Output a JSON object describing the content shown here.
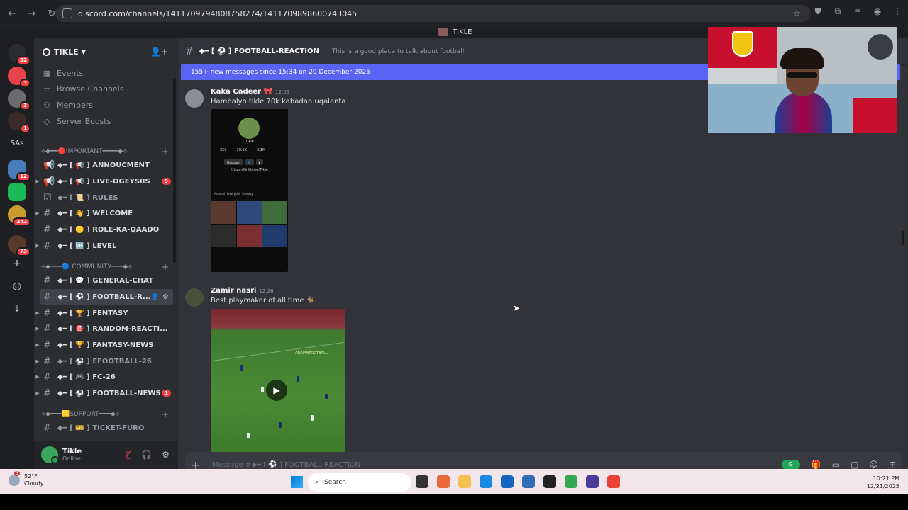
{
  "browser": {
    "url": "discord.com/channels/1411709794808758274/1411709898600743045"
  },
  "window": {
    "title": "TIKLE"
  },
  "guilds": {
    "badges": [
      "32",
      "3",
      "3",
      "1",
      "12",
      "242",
      "73"
    ],
    "sas_label": "SAs"
  },
  "server": {
    "name": "TIKLE",
    "nav": [
      {
        "label": "Events",
        "icon": "calendar-icon"
      },
      {
        "label": "Browse Channels",
        "icon": "browse-icon"
      },
      {
        "label": "Members",
        "icon": "members-icon"
      },
      {
        "label": "Server Boosts",
        "icon": "boost-icon"
      }
    ],
    "categories": [
      {
        "label": "⟡◆━━🔴IMPORTANT━━━━◆⟡"
      },
      {
        "label": "⟡◆━━━🔵 COMMUNITY━━━◆⟡"
      },
      {
        "label": "⟡◆━━━🟨SUPPORT━━━◆⟡"
      }
    ],
    "channels": [
      {
        "name": "◆━ [ 📢 ] ANNOUCMENT",
        "hash": "📢",
        "badge": ""
      },
      {
        "name": "◆━ [ 📢 ] LIVE-OGEYSIIS",
        "hash": "📢",
        "badge": "9"
      },
      {
        "name": "◆━ [ 📜 ] RULES",
        "hash": "☑",
        "badge": ""
      },
      {
        "name": "◆━ [ 👋 ] WELCOME",
        "hash": "#",
        "badge": ""
      },
      {
        "name": "◆━ [ 🟡 ] ROLE-KA-QAADO",
        "hash": "#",
        "badge": ""
      },
      {
        "name": "◆━ [ 🆙 ] LEVEL",
        "hash": "#",
        "badge": ""
      },
      {
        "name": "◆━ [ 💬 ] GENERAL-CHAT",
        "hash": "#",
        "badge": ""
      },
      {
        "name": "◆━ [ ⚽ ] FOOTBALL-R...",
        "hash": "#",
        "badge": ""
      },
      {
        "name": "◆━ [ 🏆 ] FENTASY",
        "hash": "#",
        "badge": ""
      },
      {
        "name": "◆━ [ 🎯 ] RANDOM-REACTI...",
        "hash": "#",
        "badge": ""
      },
      {
        "name": "◆━ [ 🏆 ] FANTASY-NEWS",
        "hash": "#",
        "badge": ""
      },
      {
        "name": "◆━ [ ⚽ ] EFOOTBALL-26",
        "hash": "#",
        "badge": ""
      },
      {
        "name": "◆━ [ 🎮 ] FC-26",
        "hash": "#",
        "badge": ""
      },
      {
        "name": "◆━ [ ⚽ ] FOOTBALL-NEWS",
        "hash": "#",
        "badge": "1"
      },
      {
        "name": "◆━ [ 🎫 ] TICKET-FURO",
        "hash": "#",
        "badge": ""
      }
    ]
  },
  "user": {
    "name": "Tikle",
    "status": "Online"
  },
  "channel": {
    "name": "◆━ [ ⚽ ] FOOTBALL-REACTION",
    "topic": "This is a good place to talk about football",
    "new_messages": "155+ new messages since 15:34 on 20 December 2025"
  },
  "messages": [
    {
      "author": "Kaka Cadeer 🎀",
      "time": "12:05",
      "text": "Hambalyo tikle 70k kabadan uqalanta",
      "attachment": {
        "profile_name": "Tikle",
        "stats": [
          "920",
          "70.1K",
          "3.1M"
        ],
        "buttons": [
          "Message",
          "👤",
          "▾"
        ],
        "link": "https://linktr.ee/Tikle",
        "tabs": [
          "Arsenal",
          "Liverpool",
          "Fantasy"
        ]
      }
    },
    {
      "author": "Zamir nasri",
      "time": "12:26",
      "text": "Best playmaker of all time 🐐",
      "attachment": {
        "watermark": "ADRIANFOOTBALL"
      }
    }
  ],
  "composer": {
    "placeholder": "Message #◆━ [ ⚽ ] FOOTBALL-REACTION"
  },
  "taskbar": {
    "weather_temp": "52°F",
    "weather_desc": "Cloudy",
    "weather_badge": "3",
    "search_label": "Search",
    "time": "10:21 PM",
    "date": "12/21/2025"
  },
  "colors": {
    "accent": "#5865f2",
    "danger": "#f23f43",
    "online": "#23a55a",
    "sidebar": "#2b2d31",
    "chat": "#313338"
  }
}
